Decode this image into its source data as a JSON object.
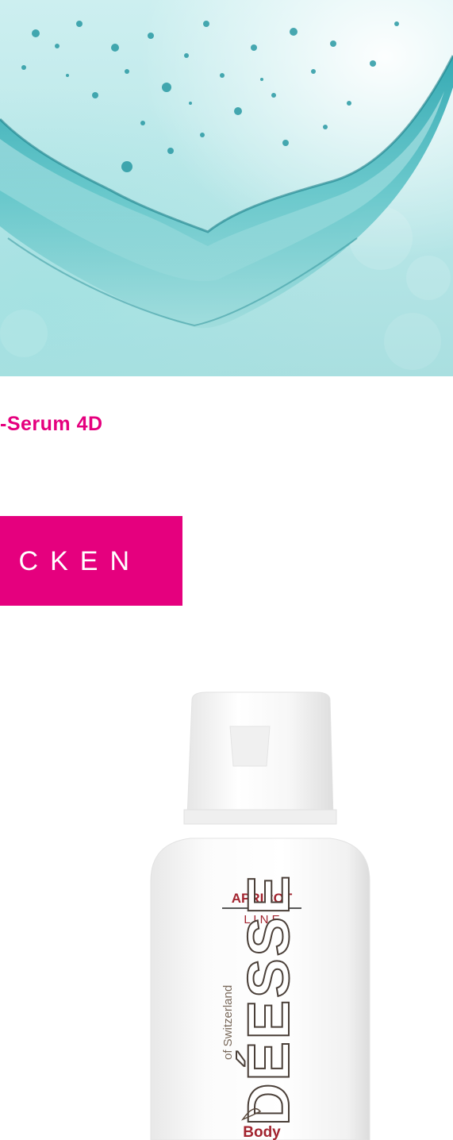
{
  "hero": {
    "image": "water-splash-image"
  },
  "product": {
    "title": "-Serum 4D",
    "cta_label": "CKEN"
  },
  "bottle": {
    "label_line1": "APRICOT",
    "label_line2": "L I N E",
    "brand_sub": "of Switzerland",
    "brand": "DÉESSE",
    "type": "Body"
  },
  "colors": {
    "accent": "#e5007e",
    "label_red": "#a2242f"
  }
}
